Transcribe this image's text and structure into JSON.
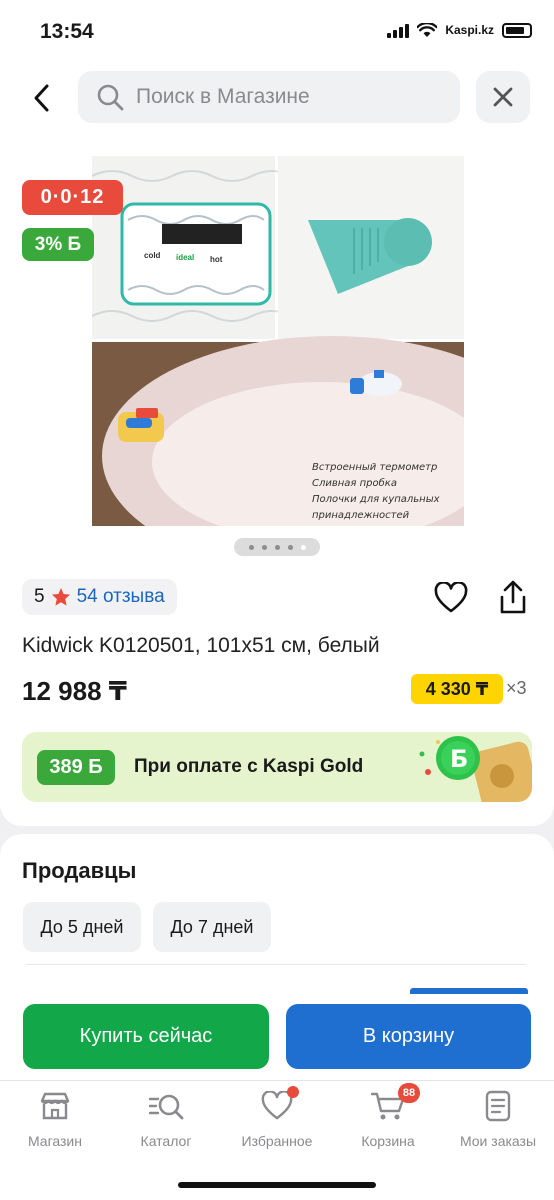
{
  "status_bar": {
    "time": "13:54",
    "carrier": "Kaspi.kz"
  },
  "header": {
    "back_icon": "chevron-left-icon",
    "search_placeholder": "Поиск в Магазине",
    "close_icon": "close-icon"
  },
  "gallery": {
    "timer_badge": "0·0·12",
    "bonus_badge": "3% Б",
    "photo_caption": [
      "Встроенный термометр",
      "Сливная пробка",
      "Полочки для купальных",
      "принадлежностей"
    ],
    "thermometer_labels": [
      "cold",
      "ideal",
      "hot"
    ],
    "dots_count": 5,
    "active_dot": 4
  },
  "product": {
    "rating": "5",
    "reviews": "54 отзыва",
    "title": "Kidwick K0120501, 101х51 см, белый",
    "price": "12 988 ₸",
    "credit_price": "4 330 ₸",
    "credit_multiplier": "×3"
  },
  "gold_banner": {
    "bonus": "389 Б",
    "text": "При оплате с Kaspi Gold"
  },
  "sellers": {
    "title": "Продавцы",
    "filters": [
      "До 5 дней",
      "До 7 дней"
    ]
  },
  "actions": {
    "buy": "Купить сейчас",
    "cart": "В корзину"
  },
  "tabbar": {
    "items": [
      {
        "label": "Магазин",
        "icon": "store-icon"
      },
      {
        "label": "Каталог",
        "icon": "catalog-search-icon"
      },
      {
        "label": "Избранное",
        "icon": "heart-icon"
      },
      {
        "label": "Корзина",
        "icon": "cart-icon",
        "badge": "88"
      },
      {
        "label": "Мои заказы",
        "icon": "orders-icon"
      }
    ]
  },
  "colors": {
    "accent_red": "#e84a3c",
    "green": "#12a84a",
    "blue": "#1f6fd1",
    "yellow": "#ffd400"
  }
}
